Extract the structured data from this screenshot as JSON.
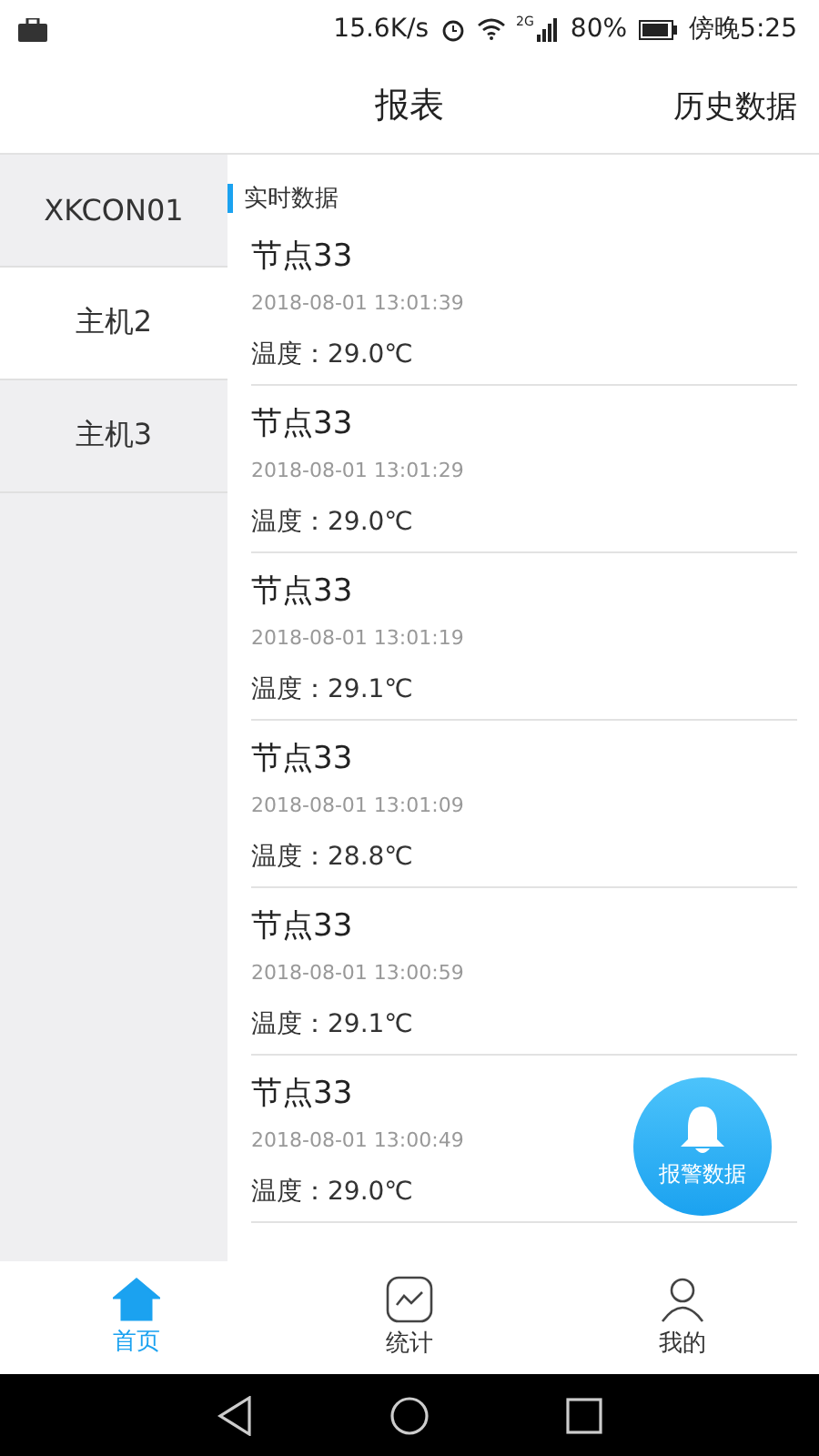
{
  "status_bar": {
    "speed": "15.6K/s",
    "network": "2G",
    "battery": "80%",
    "time": "傍晚5:25"
  },
  "header": {
    "title": "报表",
    "action": "历史数据"
  },
  "sidebar": {
    "items": [
      {
        "label": "XKCON01",
        "selected": false
      },
      {
        "label": "主机2",
        "selected": true
      },
      {
        "label": "主机3",
        "selected": false
      }
    ]
  },
  "section_title": "实时数据",
  "records": [
    {
      "name": "节点33",
      "time": "2018-08-01 13:01:39",
      "reading": "温度：29.0℃"
    },
    {
      "name": "节点33",
      "time": "2018-08-01 13:01:29",
      "reading": "温度：29.0℃"
    },
    {
      "name": "节点33",
      "time": "2018-08-01 13:01:19",
      "reading": "温度：29.1℃"
    },
    {
      "name": "节点33",
      "time": "2018-08-01 13:01:09",
      "reading": "温度：28.8℃"
    },
    {
      "name": "节点33",
      "time": "2018-08-01 13:00:59",
      "reading": "温度：29.1℃"
    },
    {
      "name": "节点33",
      "time": "2018-08-01 13:00:49",
      "reading": "温度：29.0℃"
    }
  ],
  "alarm_button": "报警数据",
  "tabs": [
    {
      "label": "首页",
      "kind": "home",
      "selected": true
    },
    {
      "label": "统计",
      "kind": "chart",
      "selected": false
    },
    {
      "label": "我的",
      "kind": "user",
      "selected": false
    }
  ]
}
